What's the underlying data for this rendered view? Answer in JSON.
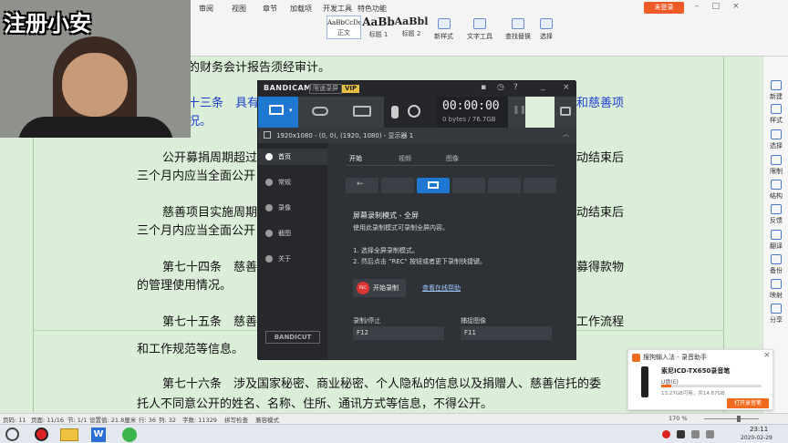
{
  "ribbon": {
    "tabs": [
      "审阅",
      "视图",
      "章节",
      "加载项",
      "开发工具",
      "特色功能"
    ],
    "styles": [
      {
        "preview": "AaBbCcDd",
        "name": "正文"
      },
      {
        "preview": "AaBb",
        "name": "标题 1"
      },
      {
        "preview": "AaBbl",
        "name": "标题 2"
      }
    ],
    "new_style": "新样式",
    "text_tools": "文字工具",
    "find_replace": "查找替换",
    "select": "选择",
    "login": "未登录"
  },
  "watermark": "注册小安",
  "document": {
    "lines": [
      {
        "text": "的财务会计报告须经审计。",
        "blue": false
      },
      {
        "text": "十三条　具有",
        "blue": true
      },
      {
        "text": "和慈善项",
        "blue": true
      },
      {
        "text": "况。",
        "blue": true
      },
      {
        "text": "公开募捐周期超过",
        "blue": false
      },
      {
        "text": "动结束后",
        "blue": false
      },
      {
        "text": "三个月内应当全面公开",
        "blue": false
      },
      {
        "text": "慈善项目实施周期",
        "blue": false
      },
      {
        "text": "动结束后",
        "blue": false
      },
      {
        "text": "三个月内应当全面公开",
        "blue": false
      },
      {
        "text": "第七十四条　慈善",
        "blue": false
      },
      {
        "text": "募得款物",
        "blue": false
      },
      {
        "text": "的管理使用情况。",
        "blue": false
      },
      {
        "text": "第七十五条　慈善",
        "blue": false
      },
      {
        "text": "工作流程",
        "blue": false
      },
      {
        "text": "和工作规范等信息。",
        "blue": false
      },
      {
        "text": "第七十六条　涉及国家秘密、商业秘密、个人隐私的信息以及捐赠人、慈善信托的委",
        "blue": false
      },
      {
        "text": "托人不同意公开的姓名、名称、住所、通讯方式等信息，不得公开。",
        "blue": false
      }
    ]
  },
  "right_panel": [
    "新建",
    "样式",
    "选择",
    "限制",
    "结构",
    "反馈",
    "翻译",
    "备份",
    "映射",
    "分享"
  ],
  "bandicam": {
    "logo": "BANDICAM",
    "badge1": "限速录屏",
    "vip": "VIP",
    "timer": "00:00:00",
    "size": "0 bytes / 76.7GB",
    "resolution": "1920x1080 - (0, 0), (1920, 1080) - 显示器 1",
    "side": [
      "首页",
      "常规",
      "录像",
      "截图",
      "关于"
    ],
    "tabs": [
      "开始",
      "视频",
      "图像"
    ],
    "mode_title": "屏幕录制模式 - 全屏",
    "mode_desc": "使用此录制模式可录制全屏内容。",
    "step1": "1. 选择全屏录制模式。",
    "step2": "2. 然后点击 \"REC\" 按钮或者更下录制快捷键。",
    "rec_badge": "REC",
    "start_btn": "开始录制",
    "help_link": "查看在线帮助",
    "hotkey_rec_label": "录制/停止",
    "hotkey_rec": "F12",
    "hotkey_img_label": "捕捉图像",
    "hotkey_img": "F11",
    "bandicut": "BANDICUT"
  },
  "statusbar": {
    "page": "页码: 11",
    "pages": "页面: 11/16",
    "section": "节: 1/1",
    "setting": "设置值: 21.8厘米",
    "row": "行: 36",
    "col": "列: 32",
    "words": "字数: 11329",
    "spell": "拼写检查",
    "compat": "兼容模式",
    "zoom": "170 %"
  },
  "toast": {
    "app": "搜狗输入法 - 录音助手",
    "product": "索尼ICD-TX650录音笔",
    "drive": "U盘(E)",
    "capacity": "13.27GB可用，共14.67GB",
    "button": "打开录音笔"
  },
  "taskbar": {
    "time": "23:11",
    "date": "2020-02-29"
  }
}
